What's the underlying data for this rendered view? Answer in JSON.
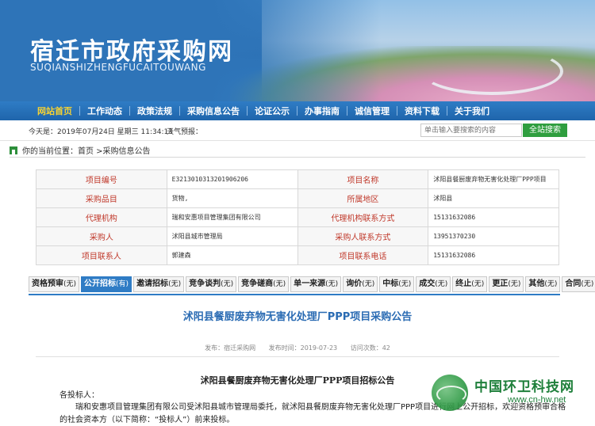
{
  "header": {
    "title": "宿迁市政府采购网",
    "pinyin": "SUQIANSHIZHENGFUCAITOUWANG"
  },
  "nav": {
    "items": [
      "网站首页",
      "工作动态",
      "政策法规",
      "采购信息公告",
      "论证公示",
      "办事指南",
      "诚信管理",
      "资料下载",
      "关于我们"
    ],
    "active": "网站首页"
  },
  "infobar": {
    "date": "今天是：2019年07月24日 星期三 11:34:13",
    "weather": "天气预报：",
    "search_placeholder": "单击输入要搜索的内容",
    "search_button": "全站搜索"
  },
  "breadcrumb": "你的当前位置：首页 >采购信息公告",
  "details": {
    "rows": [
      {
        "l1": "项目编号",
        "v1": "E3213010313201906206",
        "l2": "项目名称",
        "v2": "沭阳县餐厨废弃物无害化处理厂PPP项目"
      },
      {
        "l1": "采购品目",
        "v1": "货物,",
        "l2": "所属地区",
        "v2": "沭阳县"
      },
      {
        "l1": "代理机构",
        "v1": "瑞和安惠项目管理集团有限公司",
        "l2": "代理机构联系方式",
        "v2": "15131632086"
      },
      {
        "l1": "采购人",
        "v1": "沭阳县城市管理局",
        "l2": "采购人联系方式",
        "v2": "13951370230"
      },
      {
        "l1": "项目联系人",
        "v1": "郭建森",
        "l2": "项目联系电话",
        "v2": "15131632086"
      }
    ]
  },
  "tabs": [
    {
      "label": "资格预审",
      "count": "(无)"
    },
    {
      "label": "公开招标",
      "count": "(有)"
    },
    {
      "label": "邀请招标",
      "count": "(无)"
    },
    {
      "label": "竞争谈判",
      "count": "(无)"
    },
    {
      "label": "竞争磋商",
      "count": "(无)"
    },
    {
      "label": "单一来源",
      "count": "(无)"
    },
    {
      "label": "询价",
      "count": "(无)"
    },
    {
      "label": "中标",
      "count": "(无)"
    },
    {
      "label": "成交",
      "count": "(无)"
    },
    {
      "label": "终止",
      "count": "(无)"
    },
    {
      "label": "更正",
      "count": "(无)"
    },
    {
      "label": "其他",
      "count": "(无)"
    },
    {
      "label": "合同",
      "count": "(无)"
    }
  ],
  "article": {
    "title": "沭阳县餐厨废弃物无害化处理厂PPP项目采购公告",
    "source": "发布：宿迁采购网",
    "published": "发布时间：2019-07-23",
    "views": "访问次数：42",
    "subtitle": "沭阳县餐厨废弃物无害化处理厂PPP项目招标公告",
    "greeting": "各投标人：",
    "paragraph": "瑞和安惠项目管理集团有限公司受沭阳县城市管理局委托，就沭阳县餐厨废弃物无害化处理厂PPP项目进行网上公开招标，欢迎资格预审合格的社会资本方（以下简称：“投标人”）前来投标。"
  },
  "watermark": {
    "name": "中国环卫科技网",
    "url": "www.cn-hw.net"
  },
  "colors": {
    "nav_bg": "#2f7cc5",
    "nav_active": "#f6d233",
    "label_red": "#c0392b",
    "title_blue": "#2a6bb3",
    "search_green": "#2f9e3f"
  }
}
